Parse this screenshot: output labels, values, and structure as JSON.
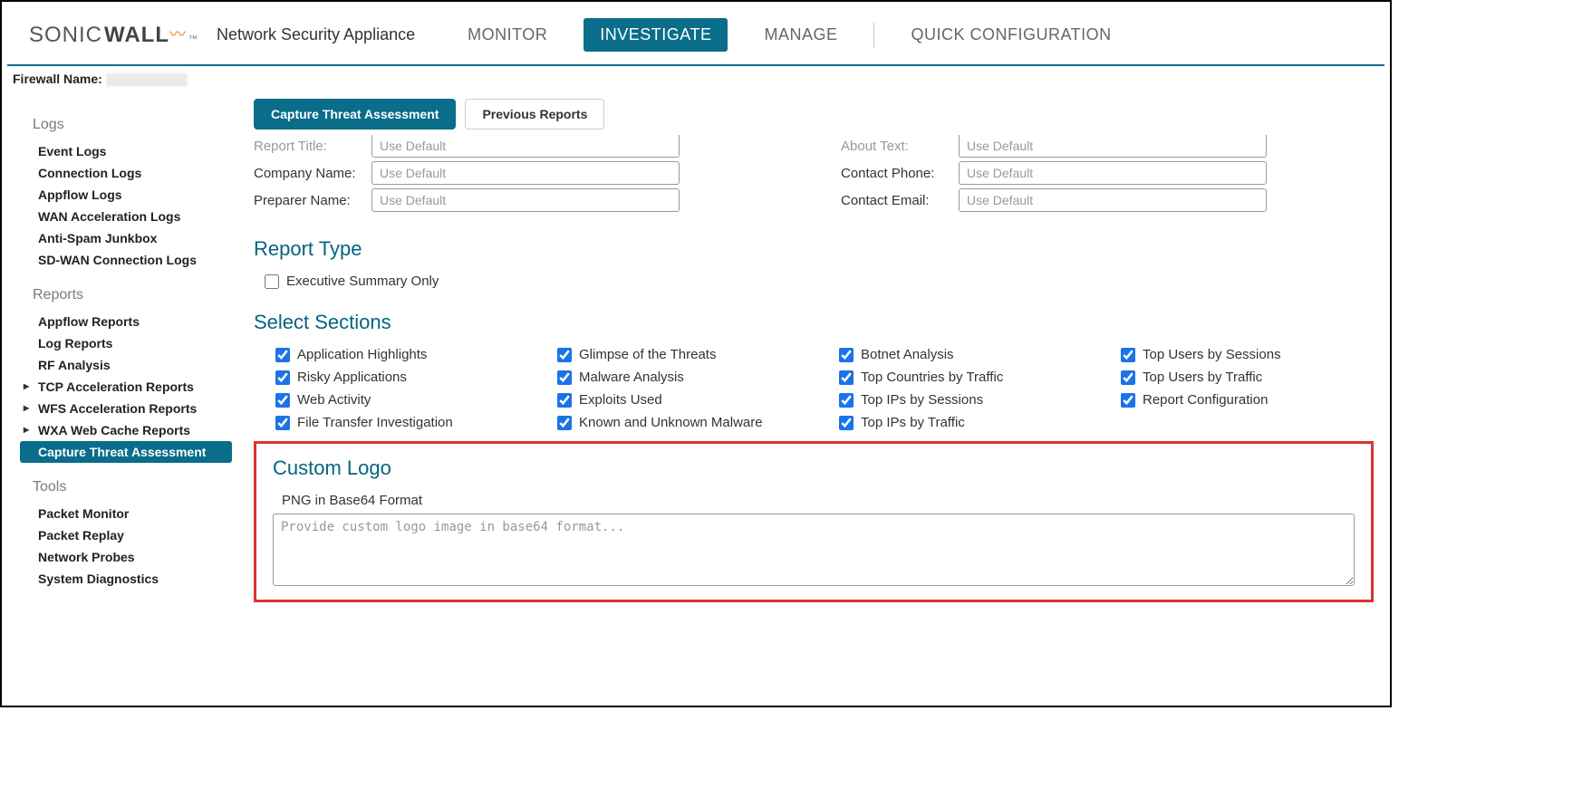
{
  "brand": {
    "sonic": "SONIC",
    "wall": "WALL",
    "tm": "™"
  },
  "appliance": "Network Security Appliance",
  "topnav": {
    "monitor": "MONITOR",
    "investigate": "INVESTIGATE",
    "manage": "MANAGE",
    "quick": "QUICK CONFIGURATION"
  },
  "firewall_label": "Firewall Name:",
  "tabs": {
    "capture": "Capture Threat Assessment",
    "previous": "Previous Reports"
  },
  "sidebar": {
    "logs_header": "Logs",
    "logs": [
      "Event Logs",
      "Connection Logs",
      "Appflow Logs",
      "WAN Acceleration Logs",
      "Anti-Spam Junkbox",
      "SD-WAN Connection Logs"
    ],
    "reports_header": "Reports",
    "reports": [
      {
        "label": "Appflow Reports",
        "caret": false
      },
      {
        "label": "Log Reports",
        "caret": false
      },
      {
        "label": "RF Analysis",
        "caret": false
      },
      {
        "label": "TCP Acceleration Reports",
        "caret": true
      },
      {
        "label": "WFS Acceleration Reports",
        "caret": true
      },
      {
        "label": "WXA Web Cache Reports",
        "caret": true
      },
      {
        "label": "Capture Threat Assessment",
        "caret": false,
        "active": true
      }
    ],
    "tools_header": "Tools",
    "tools": [
      "Packet Monitor",
      "Packet Replay",
      "Network Probes",
      "System Diagnostics"
    ]
  },
  "fields": {
    "report_title": {
      "label": "Report Title:",
      "placeholder": "Use Default"
    },
    "company_name": {
      "label": "Company Name:",
      "placeholder": "Use Default"
    },
    "preparer_name": {
      "label": "Preparer Name:",
      "placeholder": "Use Default"
    },
    "about_text": {
      "label": "About Text:",
      "placeholder": "Use Default"
    },
    "contact_phone": {
      "label": "Contact Phone:",
      "placeholder": "Use Default"
    },
    "contact_email": {
      "label": "Contact Email:",
      "placeholder": "Use Default"
    }
  },
  "report_type": {
    "title": "Report Type",
    "exec_only": "Executive Summary Only"
  },
  "select_sections": {
    "title": "Select Sections",
    "items": [
      "Application Highlights",
      "Glimpse of the Threats",
      "Botnet Analysis",
      "Top Users by Sessions",
      "Risky Applications",
      "Malware Analysis",
      "Top Countries by Traffic",
      "Top Users by Traffic",
      "Web Activity",
      "Exploits Used",
      "Top IPs by Sessions",
      "Report Configuration",
      "File Transfer Investigation",
      "Known and Unknown Malware",
      "Top IPs by Traffic"
    ]
  },
  "custom_logo": {
    "title": "Custom Logo",
    "sub": "PNG in Base64 Format",
    "placeholder": "Provide custom logo image in base64 format..."
  }
}
